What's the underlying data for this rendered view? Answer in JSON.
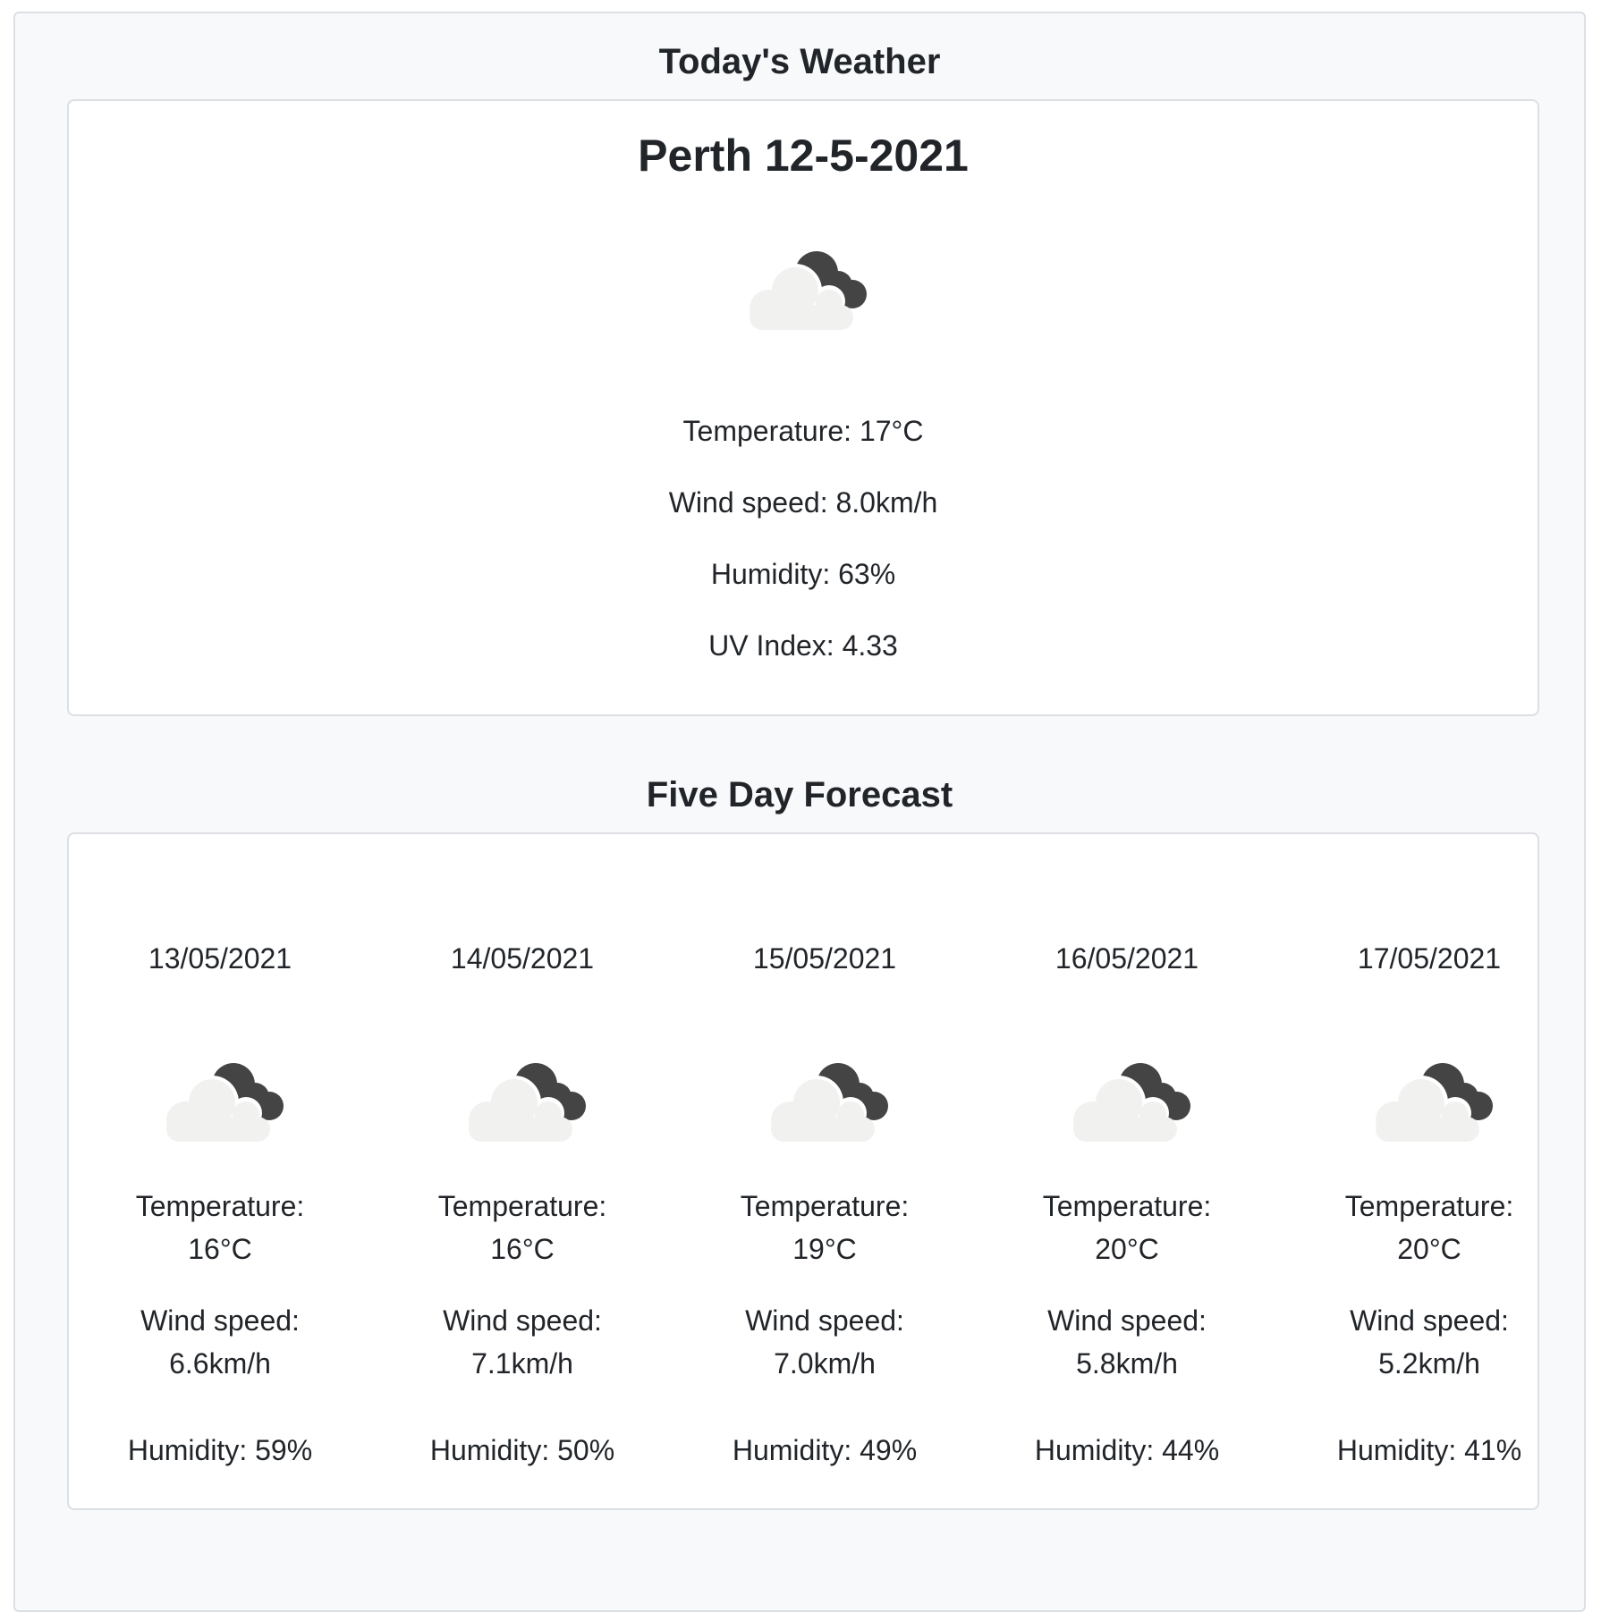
{
  "today": {
    "heading": "Today's Weather",
    "city_date": "Perth 12-5-2021",
    "icon": "night-cloudy-icon",
    "temperature": "Temperature: 17°C",
    "wind": "Wind speed: 8.0km/h",
    "humidity": "Humidity: 63%",
    "uv": "UV Index: 4.33"
  },
  "forecast": {
    "heading": "Five Day Forecast",
    "days": [
      {
        "date": "13/05/2021",
        "icon": "night-cloudy-icon",
        "temperature": "Temperature: 16°C",
        "wind": "Wind speed: 6.6km/h",
        "humidity": "Humidity: 59%"
      },
      {
        "date": "14/05/2021",
        "icon": "night-cloudy-icon",
        "temperature": "Temperature: 16°C",
        "wind": "Wind speed: 7.1km/h",
        "humidity": "Humidity: 50%"
      },
      {
        "date": "15/05/2021",
        "icon": "night-cloudy-icon",
        "temperature": "Temperature: 19°C",
        "wind": "Wind speed: 7.0km/h",
        "humidity": "Humidity: 49%"
      },
      {
        "date": "16/05/2021",
        "icon": "night-cloudy-icon",
        "temperature": "Temperature: 20°C",
        "wind": "Wind speed: 5.8km/h",
        "humidity": "Humidity: 44%"
      },
      {
        "date": "17/05/2021",
        "icon": "night-cloudy-icon",
        "temperature": "Temperature: 20°C",
        "wind": "Wind speed: 5.2km/h",
        "humidity": "Humidity: 41%"
      }
    ]
  },
  "colors": {
    "cloud_light": "#f1f1f0",
    "cloud_dark": "#444444",
    "panel_bg": "#f8f9fa",
    "card_border": "#dcdfe3",
    "text": "#212529"
  }
}
